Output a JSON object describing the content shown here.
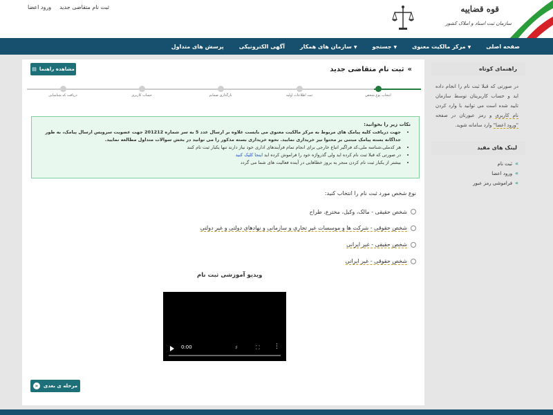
{
  "top_links": {
    "register": "ثبت نام متقاضی جدید",
    "login": "ورود اعضا"
  },
  "logo": {
    "title": "قوه قضاییه",
    "subtitle": "سازمان ثبت اسناد و املاک کشور"
  },
  "nav": [
    "صفحه اصلی",
    "مرکز مالکیت معنوی",
    "جستجو",
    "سازمان های همکار",
    "آگهی الکترونیکی",
    "پرسش های متداول"
  ],
  "main": {
    "help_button": "مشاهده راهنما",
    "page_title": "ثبت نام متقاضی جدید",
    "steps": [
      "انتخاب نوع شخص",
      "ثبت اطلاعات اولیه",
      "بارگذاری ضمایم",
      "حساب کاربری",
      "دریافت کد شناسایی"
    ],
    "alert": {
      "title": "نکات زیر را بخوانید:",
      "items": [
        "جهت دریافت کلیه پیامک های مربوط به مرکز مالکیت معنوی می بایست علاوه بر ارسال عدد 5 به سر شماره 201212 جهت عضویت سرویس ارسال پیامک، به طور جداگانه بسته پیامک مبتنی بر محتوا نیز خریداری نمایید. نحوه خریداری بسته مذکور را می توانید در بخش سوالات متداول مطالعه نمایید.",
        "هر کدملی،شناسه ملی،کد فراگیر اتباع خارجی برای انجام تمام فرآیندهای اداری خود نیاز دارند تنها یکبار ثبت نام کنند",
        "در صورتی که قبلا ثبت نام کرده اید ولی گذرواژه خود را فراموش کرده اید",
        "بیشتر از یکبار ثبت نام کردن منجر به بروز خطاهایی در آینده فعالیت های شما می گردد"
      ],
      "link": "اینجا کلیک کنید"
    },
    "question": "نوع شخص مورد ثبت نام را انتخاب کنید:",
    "options": [
      "شخص حقیقی - مالک، وکیل، مخترع، طراح",
      "شخص حقوقی - شرکت ها و موسسات غیر تجاری و سازمانی و نهادهای دولتی و غیر دولتی",
      "شخص حقیقی - غیر ایرانی",
      "شخص حقوقی - غیر ایرانی"
    ],
    "video_title": "ویدیو آموزشی ثبت نام",
    "video_time": "0:00",
    "next_button": "مرحله ی بعدی"
  },
  "sidebar": {
    "guide_title": "راهنمای کوتاه",
    "guide_text_1": "در صورتی که قبلا ثبت نام را انجام داده اید و حساب کاربریتان توسط سازمان تایید شده است می توانید با وارد کردن",
    "guide_text_ul": "نام کاربری",
    "guide_text_2": "و رمز عبورتان در صفحه",
    "guide_text_ul2": "\"ورود اعضا\"",
    "guide_text_3": "وارد سامانه شوید.",
    "links_title": "لینک های مفید",
    "links": [
      "ثبت نام",
      "ورود اعضا",
      "فراموشی رمز عبور"
    ]
  },
  "colors": {
    "navbar": "#17506e",
    "button": "#1d6f78",
    "step_active": "#1f7a3c",
    "alert_bg": "#e8f8ee"
  }
}
